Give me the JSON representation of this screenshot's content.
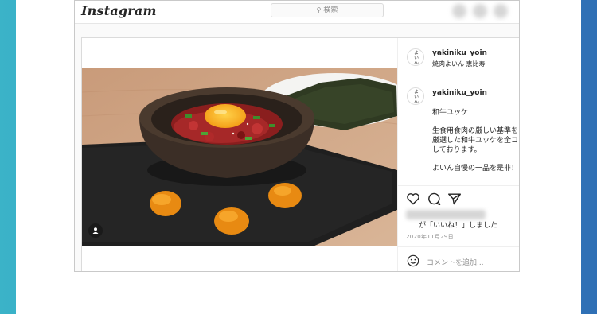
{
  "header": {
    "logo": "Instagram",
    "search_placeholder": "検索"
  },
  "post": {
    "username": "yakiniku_yoin",
    "location": "焼肉よいん 恵比寿",
    "avatar_text": "よいん",
    "caption": {
      "username": "yakiniku_yoin",
      "lines": [
        "和牛ユッケ",
        "生食用食肉の厳しい基準を",
        "厳選した和牛ユッケを全コ",
        "しております。",
        "よいん自慢の一品を是非！"
      ]
    },
    "likes_suffix": "が「いいね！」しました",
    "date": "2020年11月29日",
    "comment_placeholder": "コメントを追加..."
  },
  "colors": {
    "background_left": "#3bb3c8",
    "background_right": "#2f6fb5",
    "text_primary": "#262626",
    "text_secondary": "#8e8e8e"
  },
  "icons": [
    "search-icon",
    "home-icon",
    "direct-icon",
    "explore-icon",
    "user-tag-icon",
    "heart-icon",
    "comment-icon",
    "share-icon",
    "emoji-icon"
  ]
}
